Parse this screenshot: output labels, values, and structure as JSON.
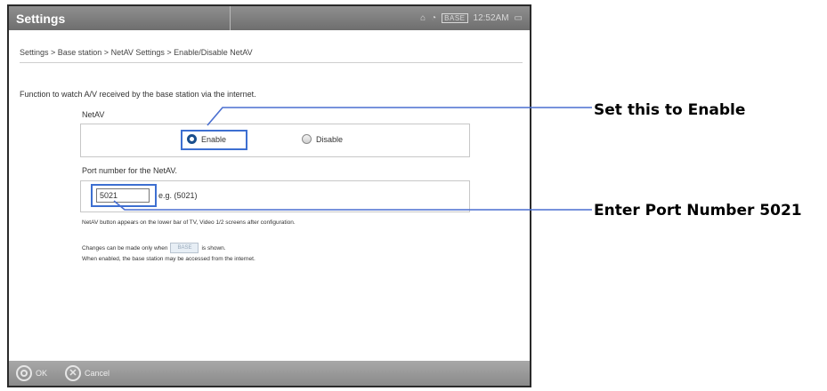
{
  "window": {
    "title": "Settings",
    "clock": "12:52AM",
    "base_badge": "BASE"
  },
  "breadcrumb": "Settings > Base station > NetAV Settings > Enable/Disable NetAV",
  "intro": "Function to watch A/V received by the base station via the internet.",
  "netav": {
    "label": "NetAV",
    "options": [
      {
        "label": "Enable",
        "selected": true
      },
      {
        "label": "Disable",
        "selected": false
      }
    ]
  },
  "port": {
    "label": "Port number for the NetAV.",
    "value": "5021",
    "example": "e.g.  (5021)"
  },
  "notes": {
    "line1": "NetAV button appears on the lower bar of TV, Video 1/2 screens after configuration.",
    "line2_prefix": "Changes can be made only when",
    "line2_badge": "BASE",
    "line2_suffix": "is shown.",
    "line3": "When enabled, the base station may be accessed from the internet."
  },
  "bottombar": {
    "ok_label": "OK",
    "cancel_label": "Cancel"
  },
  "callouts": {
    "enable": "Set this to Enable",
    "port": "Enter Port Number 5021"
  },
  "colors": {
    "highlight": "#3d6fd1",
    "leader_line": "#4a6fd0",
    "titlebar": "#7a7a7a",
    "radio_selected": "#1a4f8e"
  }
}
